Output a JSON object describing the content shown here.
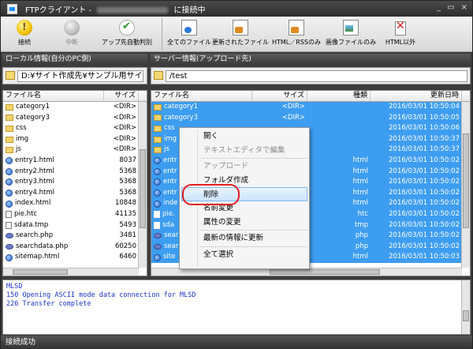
{
  "window": {
    "title_prefix": "FTPクライアント -",
    "title_suffix": "に接続中",
    "controls": [
      "_",
      "▭",
      "×"
    ]
  },
  "toolbar": {
    "connect": "接続",
    "disconnect": "中断",
    "auto_detect": "アップ先自動判別",
    "all_files": "全てのファイル",
    "updated_files": "更新されたファイル",
    "html_rss": "HTML／RSSのみ",
    "image_files": "画像ファイルのみ",
    "non_html": "HTML以外"
  },
  "local": {
    "header": "ローカル情報(自分のPC側)",
    "path": "D:¥サイト作成先¥サンプル用サイト",
    "col_name": "ファイル名",
    "col_size": "サイズ",
    "files": [
      {
        "name": "category1",
        "size": "<DIR>",
        "type": "folder"
      },
      {
        "name": "category3",
        "size": "<DIR>",
        "type": "folder"
      },
      {
        "name": "css",
        "size": "<DIR>",
        "type": "folder"
      },
      {
        "name": "img",
        "size": "<DIR>",
        "type": "folder"
      },
      {
        "name": "js",
        "size": "<DIR>",
        "type": "folder"
      },
      {
        "name": "entry1.html",
        "size": "8037",
        "type": "html"
      },
      {
        "name": "entry2.html",
        "size": "5368",
        "type": "html"
      },
      {
        "name": "entry3.html",
        "size": "5368",
        "type": "html"
      },
      {
        "name": "entry4.html",
        "size": "5368",
        "type": "html"
      },
      {
        "name": "index.html",
        "size": "10848",
        "type": "html"
      },
      {
        "name": "pie.htc",
        "size": "41135",
        "type": "doc"
      },
      {
        "name": "sdata.tmp",
        "size": "5493",
        "type": "doc"
      },
      {
        "name": "search.php",
        "size": "3481",
        "type": "php"
      },
      {
        "name": "searchdata.php",
        "size": "60250",
        "type": "php"
      },
      {
        "name": "sitemap.html",
        "size": "6460",
        "type": "html"
      }
    ]
  },
  "remote": {
    "header": "サーバー情報(アップロード先)",
    "path": "/test",
    "col_name": "ファイル名",
    "col_size": "サイズ",
    "col_type": "種類",
    "col_date": "更新日時",
    "files": [
      {
        "name": "category1",
        "size": "<DIR>",
        "kind": "",
        "date": "2016/03/01 10:50:04",
        "type": "folder"
      },
      {
        "name": "category3",
        "size": "<DIR>",
        "kind": "",
        "date": "2016/03/01 10:50:05",
        "type": "folder"
      },
      {
        "name": "css",
        "size": "",
        "kind": "",
        "date": "2016/03/01 10:50:06",
        "type": "folder"
      },
      {
        "name": "img",
        "size": "",
        "kind": "",
        "date": "2016/03/01 10:50:37",
        "type": "folder"
      },
      {
        "name": "js",
        "size": "",
        "kind": "",
        "date": "2016/03/01 10:50:37",
        "type": "folder"
      },
      {
        "name": "entr",
        "size": "",
        "kind": "html",
        "date": "2016/03/01 10:50:02",
        "type": "html"
      },
      {
        "name": "entr",
        "size": "",
        "kind": "html",
        "date": "2016/03/01 10:50:02",
        "type": "html"
      },
      {
        "name": "entr",
        "size": "",
        "kind": "html",
        "date": "2016/03/01 10:50:02",
        "type": "html"
      },
      {
        "name": "entr",
        "size": "",
        "kind": "html",
        "date": "2016/03/01 10:50:02",
        "type": "html"
      },
      {
        "name": "inde",
        "size": "",
        "kind": "html",
        "date": "2016/03/01 10:50:02",
        "type": "html"
      },
      {
        "name": "pie.",
        "size": "",
        "kind": "htc",
        "date": "2016/03/01 10:50:02",
        "type": "doc"
      },
      {
        "name": "sda",
        "size": "",
        "kind": "tmp",
        "date": "2016/03/01 10:50:02",
        "type": "doc"
      },
      {
        "name": "sear",
        "size": "",
        "kind": "php",
        "date": "2016/03/01 10:50:02",
        "type": "php"
      },
      {
        "name": "sear",
        "size": "",
        "kind": "php",
        "date": "2016/03/01 10:50:02",
        "type": "php"
      },
      {
        "name": "site",
        "size": "",
        "kind": "html",
        "date": "2016/03/01 10:50:03",
        "type": "html"
      }
    ]
  },
  "context_menu": [
    {
      "label": "開く",
      "state": "enabled"
    },
    {
      "label": "テキストエディタで編集",
      "state": "disabled"
    },
    {
      "sep": true
    },
    {
      "label": "アップロード",
      "state": "disabled"
    },
    {
      "label": "フォルダ作成",
      "state": "enabled"
    },
    {
      "label": "削除",
      "state": "highlighted"
    },
    {
      "label": "名前変更",
      "state": "enabled"
    },
    {
      "label": "属性の変更",
      "state": "enabled"
    },
    {
      "sep": true
    },
    {
      "label": "最新の情報に更新",
      "state": "enabled"
    },
    {
      "sep": true
    },
    {
      "label": "全て選択",
      "state": "enabled"
    }
  ],
  "log": {
    "lines": [
      "MLSD",
      "150 Opening ASCII mode data connection for MLSD",
      "226 Transfer complete"
    ]
  },
  "status": {
    "text": "接続成功"
  },
  "colors": {
    "selection": "#3d9df0",
    "log_text": "#1a34c6",
    "annotation": "#e02020"
  }
}
